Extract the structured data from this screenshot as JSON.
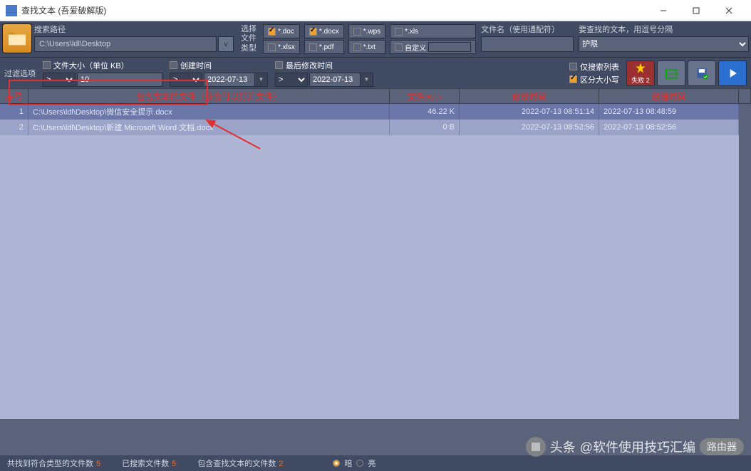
{
  "window": {
    "title": "查找文本 (吾爱破解版)"
  },
  "path": {
    "label": "搜索路径",
    "value": "C:\\Users\\ldl\\Desktop",
    "btn": "v"
  },
  "filetype": {
    "label": "选择文件类型",
    "items": [
      {
        "label": "*.doc",
        "checked": true
      },
      {
        "label": "*.docx",
        "checked": true
      },
      {
        "label": "*.wps",
        "checked": false
      },
      {
        "label": "*.xls",
        "checked": false
      },
      {
        "label": "*.xlsx",
        "checked": false
      },
      {
        "label": "*.pdf",
        "checked": false
      },
      {
        "label": "*.txt",
        "checked": false
      }
    ],
    "custom": "自定义"
  },
  "filename": {
    "label": "文件名（使用通配符）"
  },
  "searchtext": {
    "label": "要查找的文本，用逗号分隔",
    "select": "护限"
  },
  "filter": {
    "label": "过滤选项",
    "filesize": {
      "label": "文件大小（单位 KB）",
      "op": ">",
      "val": "10"
    },
    "createtime": {
      "label": "创建时间",
      "op": ">",
      "val": "2022-07-13"
    },
    "modtime": {
      "label": "最后修改时间",
      "op": ">",
      "val": "2022-07-13"
    }
  },
  "opts": {
    "searchlist": "仅搜索列表",
    "casesens": "区分大小写"
  },
  "actions": {
    "fail": "失败 2"
  },
  "table": {
    "headers": [
      "序号",
      "包含文本的文件（双击可以打开文件）",
      "文件大小",
      "修改时间",
      "创建时间"
    ],
    "rows": [
      {
        "idx": "1",
        "path": "C:\\Users\\ldl\\Desktop\\微信安全提示.docx",
        "size": "46.22 K",
        "mod": "2022-07-13 08:51:14",
        "create": "2022-07-13 08:48:59"
      },
      {
        "idx": "2",
        "path": "C:\\Users\\ldl\\Desktop\\新建 Microsoft Word 文档.docx",
        "size": "0 B",
        "mod": "2022-07-13 08:52:56",
        "create": "2022-07-13 08:52:56"
      }
    ]
  },
  "status": {
    "match_label": "共找到符合类型的文件数",
    "match_val": "5",
    "searched_label": "已搜索文件数",
    "searched_val": "5",
    "contain_label": "包含查找文本的文件数",
    "contain_val": "2",
    "dark": "暗",
    "light": "亮"
  },
  "watermark": {
    "brand": "头条",
    "text": "@软件使用技巧汇编",
    "badge": "路由器"
  }
}
